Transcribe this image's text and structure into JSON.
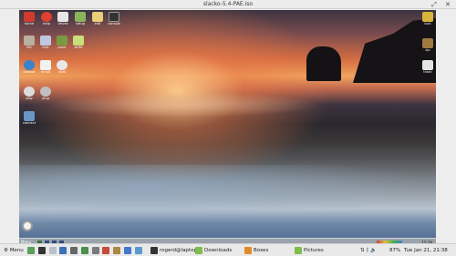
{
  "window": {
    "title": "slacko-5.4-PAE.iso",
    "controls": [
      "restore-down",
      "close"
    ]
  },
  "desktop": {
    "top_icons": [
      {
        "label": "home",
        "icon": "home-icon",
        "color": "#d23a2f"
      },
      {
        "label": "help",
        "icon": "lifebuoy-icon",
        "color": "#e04030"
      },
      {
        "label": "drives",
        "icon": "drive-icon",
        "color": "#e6e6e6"
      },
      {
        "label": "setup",
        "icon": "setup-icon",
        "color": "#8bb35a"
      },
      {
        "label": "edit",
        "icon": "notepad-icon",
        "color": "#e8d07a"
      },
      {
        "label": "console",
        "icon": "terminal-icon",
        "color": "#333333"
      }
    ],
    "row2_icons": [
      {
        "label": "file",
        "icon": "document-icon",
        "color": "#b8b0a0"
      },
      {
        "label": "calc",
        "icon": "calculator-icon",
        "color": "#c0c8e0"
      },
      {
        "label": "paint",
        "icon": "paint-icon",
        "color": "#7a9a40"
      },
      {
        "label": "write",
        "icon": "writer-icon",
        "color": "#c7e07a"
      }
    ],
    "row3_icons": [
      {
        "label": "browse",
        "icon": "globe-icon",
        "color": "#3a82c9"
      },
      {
        "label": "email",
        "icon": "envelope-icon",
        "color": "#f1f1f1"
      },
      {
        "label": "chat",
        "icon": "chat-bubble-icon",
        "color": "#e8e8e8"
      }
    ],
    "row4_icons": [
      {
        "label": "play",
        "icon": "media-play-icon",
        "color": "#dcdcdc"
      },
      {
        "label": "plug",
        "icon": "plug-icon",
        "color": "#c0c0c0"
      }
    ],
    "row5_icons": [
      {
        "label": "connect",
        "icon": "network-icon",
        "color": "#6a96c6"
      }
    ],
    "right_icons": [
      {
        "label": "lock",
        "icon": "lock-icon",
        "color": "#d9b33a"
      },
      {
        "label": "zip",
        "icon": "archive-icon",
        "color": "#a07a40"
      },
      {
        "label": "trash",
        "icon": "trash-icon",
        "color": "#e5e5e5"
      }
    ],
    "bottom_left_icon": {
      "icon": "settings-gear-icon"
    }
  },
  "inner_taskbar": {
    "menu_label": "Menu",
    "clock": "15:38"
  },
  "taskbar": {
    "menu_label": "Menu",
    "windows": [
      {
        "label": "rogerd@laptopc:",
        "icon": "terminal-icon"
      },
      {
        "label": "Downloads",
        "icon": "folder-icon"
      },
      {
        "label": "Boxes",
        "icon": "boxes-icon"
      },
      {
        "label": "Pictures",
        "icon": "folder-icon"
      }
    ],
    "battery": "87%",
    "datetime": "Tue Jan 21, 21:38"
  }
}
